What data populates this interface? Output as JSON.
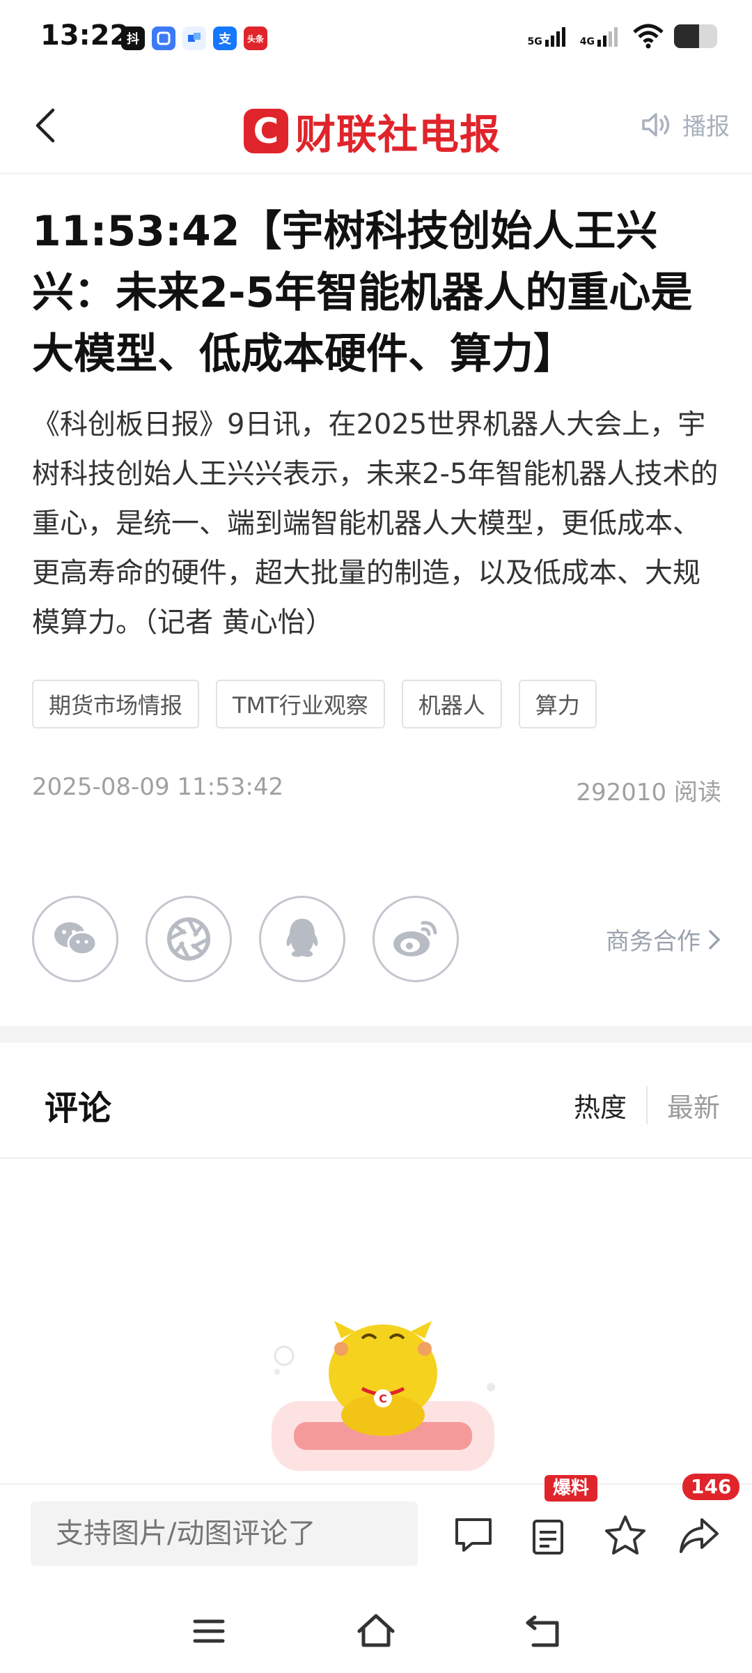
{
  "status": {
    "time": "13:22",
    "apps": [
      "抖",
      "",
      "",
      "支",
      "头条"
    ],
    "signal1": "5G",
    "signal2": "4G"
  },
  "header": {
    "logo_mark": "C",
    "logo_text": "财联社电报",
    "broadcast_label": "播报"
  },
  "article": {
    "headline": "11:53:42【宇树科技创始人王兴兴：未来2-5年智能机器人的重心是大模型、低成本硬件、算力】",
    "body": "《科创板日报》9日讯，在2025世界机器人大会上，宇树科技创始人王兴兴表示，未来2-5年智能机器人技术的重心，是统一、端到端智能机器人大模型，更低成本、更高寿命的硬件，超大批量的制造，以及低成本、大规模算力。（记者 黄心怡）",
    "tags": [
      "期货市场情报",
      "TMT行业观察",
      "机器人",
      "算力"
    ],
    "datetime": "2025-08-09 11:53:42",
    "reads": "292010 阅读"
  },
  "share": {
    "business_label": "商务合作"
  },
  "comments": {
    "title": "评论",
    "sort_hot": "热度",
    "sort_new": "最新"
  },
  "bottom_bar": {
    "input_placeholder": "支持图片/动图评论了",
    "tip_badge": "爆料",
    "share_count": "146"
  },
  "colors": {
    "brand": "#e0242b",
    "muted": "#a0a0a0"
  }
}
